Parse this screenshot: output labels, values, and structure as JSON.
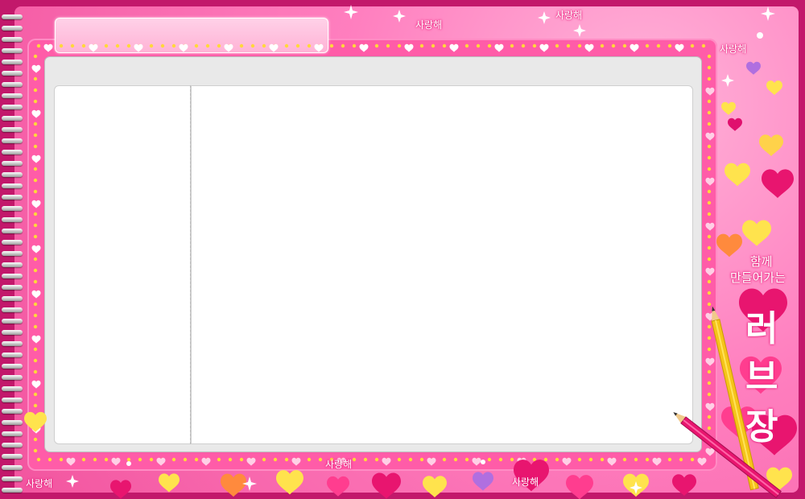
{
  "decor_text": {
    "love_word": "사랑해",
    "side_line1": "함께",
    "side_line2": "만들어가는",
    "big_char1": "러",
    "big_char2": "브",
    "big_char3": "장"
  },
  "colors": {
    "background": "#ff7fbf",
    "frame": "#ff5ca8",
    "border_dark": "#c2186b",
    "panel": "#ffffff",
    "inner_tray": "#e9e9e9"
  },
  "icons": [
    "heart-icon",
    "sparkle-icon",
    "pencil-icon",
    "spiral-binding-icon"
  ]
}
